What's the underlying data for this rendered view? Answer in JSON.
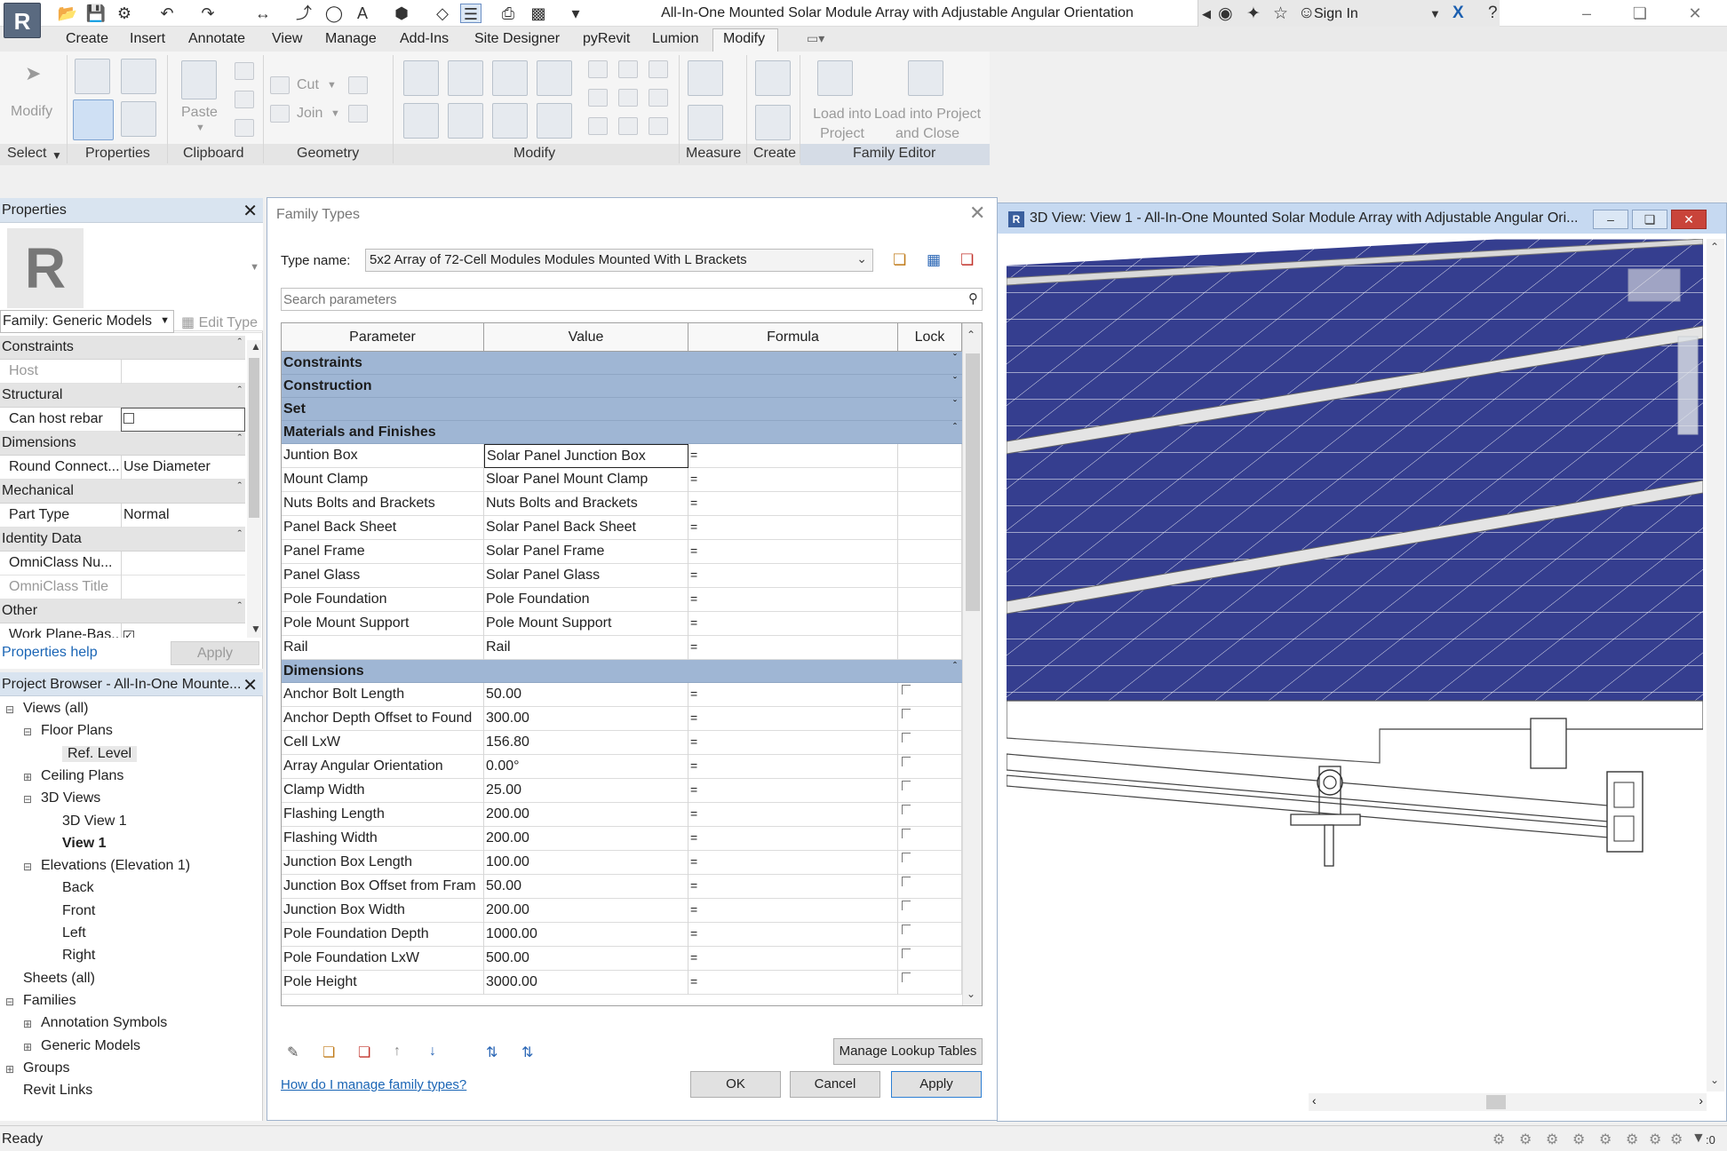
{
  "window": {
    "title": "All-In-One Mounted Solar Module Array with Adjustable Angular Orientation",
    "app_logo": "R",
    "sign_in": "Sign In"
  },
  "ribbon": {
    "tabs": [
      "Create",
      "Insert",
      "Annotate",
      "View",
      "Manage",
      "Add-Ins",
      "Site Designer",
      "pyRevit",
      "Lumion",
      "Modify"
    ],
    "active_tab": "Modify",
    "buttons": {
      "modify": "Modify",
      "paste": "Paste",
      "cut": "Cut",
      "join": "Join",
      "load_into_project": "Load into Project",
      "load_into_project_close": "Load into Project and Close"
    },
    "panels": [
      "Select",
      "Properties",
      "Clipboard",
      "Geometry",
      "Modify",
      "Measure",
      "Create",
      "Family Editor"
    ]
  },
  "properties": {
    "title": "Properties",
    "family": "Family: Generic Models",
    "edit_type": "Edit Type",
    "groups": [
      {
        "name": "Constraints",
        "rows": [
          {
            "name": "Host",
            "value": "",
            "dim": true
          }
        ]
      },
      {
        "name": "Structural",
        "rows": [
          {
            "name": "Can host rebar",
            "value": "",
            "checkbox": true
          }
        ]
      },
      {
        "name": "Dimensions",
        "rows": [
          {
            "name": "Round Connect...",
            "value": "Use Diameter"
          }
        ]
      },
      {
        "name": "Mechanical",
        "rows": [
          {
            "name": "Part Type",
            "value": "Normal"
          }
        ]
      },
      {
        "name": "Identity Data",
        "rows": [
          {
            "name": "OmniClass Nu...",
            "value": ""
          },
          {
            "name": "OmniClass Title",
            "value": "",
            "dim": true
          }
        ]
      },
      {
        "name": "Other",
        "rows": [
          {
            "name": "Work Plane-Bas...",
            "value": "",
            "checkbox": true,
            "checked": true
          }
        ]
      }
    ],
    "help_link": "Properties help",
    "apply": "Apply"
  },
  "project_browser": {
    "title": "Project Browser - All-In-One Mounte...",
    "items": [
      {
        "label": "Views (all)",
        "level": 0,
        "toggle": "-"
      },
      {
        "label": "Floor Plans",
        "level": 1,
        "toggle": "-"
      },
      {
        "label": "Ref. Level",
        "level": 2,
        "toggle": "",
        "selected": true
      },
      {
        "label": "Ceiling Plans",
        "level": 1,
        "toggle": "+"
      },
      {
        "label": "3D Views",
        "level": 1,
        "toggle": "-"
      },
      {
        "label": "3D View 1",
        "level": 2,
        "toggle": ""
      },
      {
        "label": "View 1",
        "level": 2,
        "toggle": "",
        "bold": true
      },
      {
        "label": "Elevations (Elevation 1)",
        "level": 1,
        "toggle": "-"
      },
      {
        "label": "Back",
        "level": 2,
        "toggle": ""
      },
      {
        "label": "Front",
        "level": 2,
        "toggle": ""
      },
      {
        "label": "Left",
        "level": 2,
        "toggle": ""
      },
      {
        "label": "Right",
        "level": 2,
        "toggle": ""
      },
      {
        "label": "Sheets (all)",
        "level": 0,
        "toggle": ""
      },
      {
        "label": "Families",
        "level": 0,
        "toggle": "-"
      },
      {
        "label": "Annotation Symbols",
        "level": 1,
        "toggle": "+"
      },
      {
        "label": "Generic Models",
        "level": 1,
        "toggle": "+"
      },
      {
        "label": "Groups",
        "level": 0,
        "toggle": "+"
      },
      {
        "label": "Revit Links",
        "level": 0,
        "toggle": ""
      }
    ]
  },
  "dialog": {
    "title": "Family Types",
    "type_name_label": "Type name:",
    "type_name": "5x2 Array of 72-Cell Modules Modules Mounted With L Brackets",
    "search_placeholder": "Search parameters",
    "columns": [
      "Parameter",
      "Value",
      "Formula",
      "Lock"
    ],
    "sections": [
      {
        "name": "Constraints",
        "rows": []
      },
      {
        "name": "Construction",
        "rows": []
      },
      {
        "name": "Set",
        "rows": []
      },
      {
        "name": "Materials and Finishes",
        "rows": [
          {
            "param": "Juntion Box",
            "value": "Solar Panel Junction Box",
            "formula": "=",
            "editing": true
          },
          {
            "param": "Mount Clamp",
            "value": "Sloar Panel Mount Clamp",
            "formula": "="
          },
          {
            "param": "Nuts Bolts and Brackets",
            "value": "Nuts Bolts and Brackets",
            "formula": "="
          },
          {
            "param": "Panel Back Sheet",
            "value": "Solar Panel Back Sheet",
            "formula": "="
          },
          {
            "param": "Panel Frame",
            "value": "Solar Panel Frame",
            "formula": "="
          },
          {
            "param": "Panel Glass",
            "value": "Solar Panel Glass",
            "formula": "="
          },
          {
            "param": "Pole Foundation",
            "value": "Pole Foundation",
            "formula": "="
          },
          {
            "param": "Pole Mount Support",
            "value": "Pole Mount Support",
            "formula": "="
          },
          {
            "param": "Rail",
            "value": "Rail",
            "formula": "="
          }
        ]
      },
      {
        "name": "Dimensions",
        "rows": [
          {
            "param": "Anchor Bolt Length",
            "value": "50.00",
            "formula": "=",
            "lock": true
          },
          {
            "param": "Anchor Depth Offset to Found",
            "value": "300.00",
            "formula": "=",
            "lock": true
          },
          {
            "param": "Cell LxW",
            "value": "156.80",
            "formula": "=",
            "lock": true
          },
          {
            "param": "Array Angular Orientation",
            "value": "0.00°",
            "formula": "=",
            "lock": true
          },
          {
            "param": "Clamp Width",
            "value": "25.00",
            "formula": "=",
            "lock": true
          },
          {
            "param": "Flashing Length",
            "value": "200.00",
            "formula": "=",
            "lock": true
          },
          {
            "param": "Flashing Width",
            "value": "200.00",
            "formula": "=",
            "lock": true
          },
          {
            "param": "Junction Box Length",
            "value": "100.00",
            "formula": "=",
            "lock": true
          },
          {
            "param": "Junction Box Offset from Fram",
            "value": "50.00",
            "formula": "=",
            "lock": true
          },
          {
            "param": "Junction Box Width",
            "value": "200.00",
            "formula": "=",
            "lock": true
          },
          {
            "param": "Pole Foundation Depth",
            "value": "1000.00",
            "formula": "=",
            "lock": true
          },
          {
            "param": "Pole Foundation LxW",
            "value": "500.00",
            "formula": "=",
            "lock": true
          },
          {
            "param": "Pole Height",
            "value": "3000.00",
            "formula": "=",
            "lock": true
          }
        ]
      }
    ],
    "manage_lookup": "Manage Lookup Tables",
    "help_link": "How do I manage family types?",
    "ok": "OK",
    "cancel": "Cancel",
    "apply": "Apply"
  },
  "view3d": {
    "title": "3D View: View 1 - All-In-One Mounted Solar Module Array with Adjustable Angular Ori...",
    "panel_color": "#353e8f",
    "grid_color": "#ffffff"
  },
  "status": {
    "text": "Ready",
    "filter_count": ":0"
  }
}
